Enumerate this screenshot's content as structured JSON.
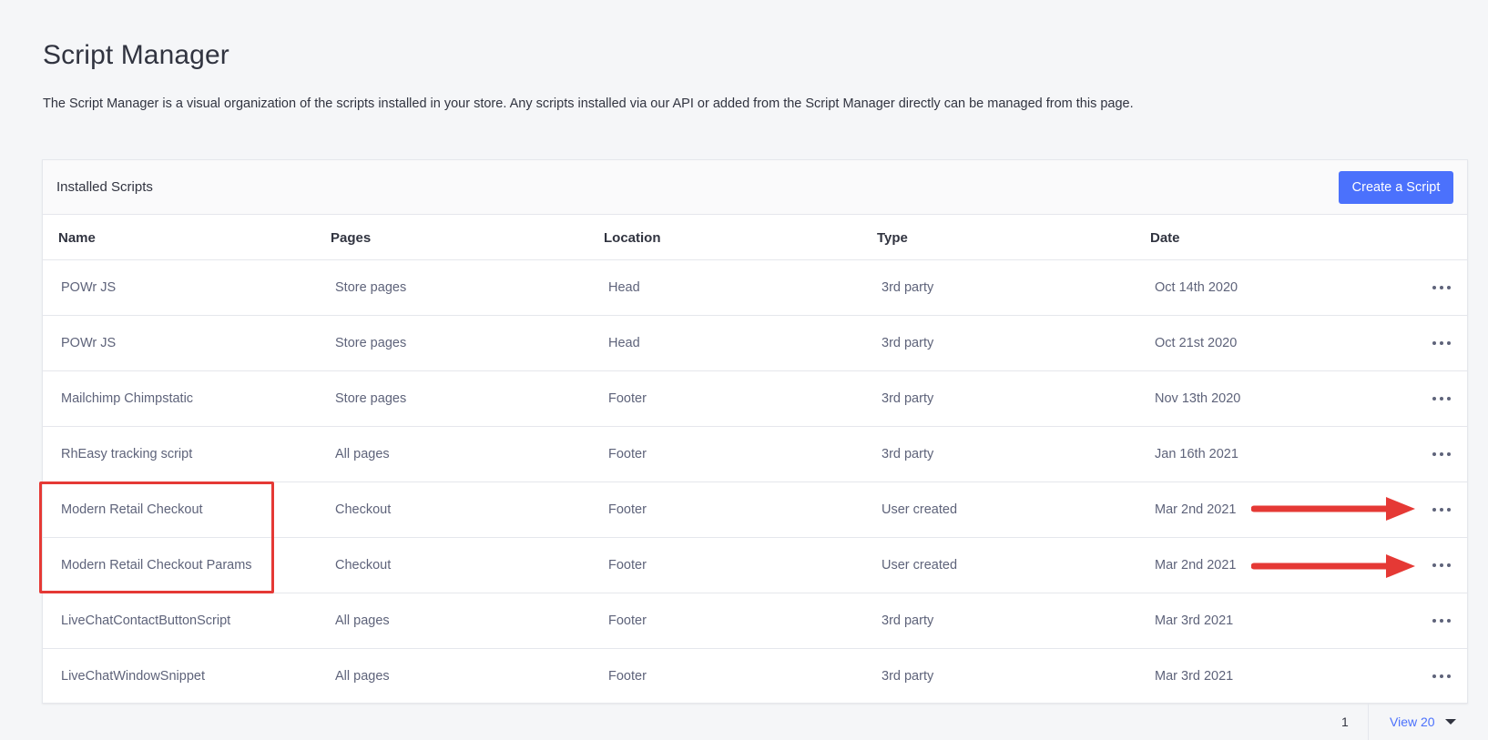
{
  "page": {
    "title": "Script Manager",
    "description": "The Script Manager is a visual organization of the scripts installed in your store. Any scripts installed via our API or added from the Script Manager directly can be managed from this page."
  },
  "panel": {
    "title": "Installed Scripts",
    "create_button": "Create a Script"
  },
  "columns": {
    "name": "Name",
    "pages": "Pages",
    "location": "Location",
    "type": "Type",
    "date": "Date"
  },
  "rows": [
    {
      "name": "POWr JS",
      "pages": "Store pages",
      "location": "Head",
      "type": "3rd party",
      "date": "Oct 14th 2020"
    },
    {
      "name": "POWr JS",
      "pages": "Store pages",
      "location": "Head",
      "type": "3rd party",
      "date": "Oct 21st 2020"
    },
    {
      "name": "Mailchimp Chimpstatic",
      "pages": "Store pages",
      "location": "Footer",
      "type": "3rd party",
      "date": "Nov 13th 2020"
    },
    {
      "name": "RhEasy tracking script",
      "pages": "All pages",
      "location": "Footer",
      "type": "3rd party",
      "date": "Jan 16th 2021"
    },
    {
      "name": "Modern Retail Checkout",
      "pages": "Checkout",
      "location": "Footer",
      "type": "User created",
      "date": "Mar 2nd 2021"
    },
    {
      "name": "Modern Retail Checkout Params",
      "pages": "Checkout",
      "location": "Footer",
      "type": "User created",
      "date": "Mar 2nd 2021"
    },
    {
      "name": "LiveChatContactButtonScript",
      "pages": "All pages",
      "location": "Footer",
      "type": "3rd party",
      "date": "Mar 3rd 2021"
    },
    {
      "name": "LiveChatWindowSnippet",
      "pages": "All pages",
      "location": "Footer",
      "type": "3rd party",
      "date": "Mar 3rd 2021"
    }
  ],
  "pagination": {
    "current_page": "1",
    "view_label": "View 20"
  },
  "colors": {
    "accent": "#4b71fc",
    "annotation": "#e53935"
  }
}
